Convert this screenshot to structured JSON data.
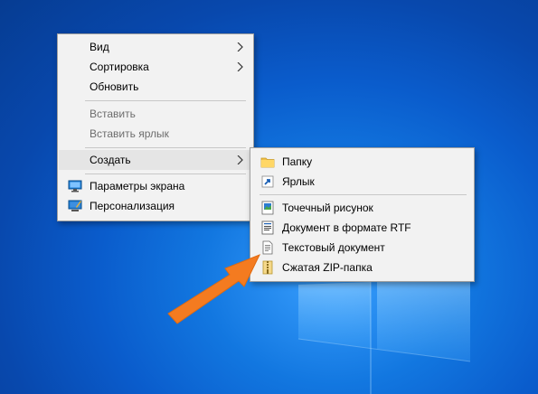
{
  "context_menu": {
    "items": [
      {
        "label": "Вид",
        "has_submenu": true
      },
      {
        "label": "Сортировка",
        "has_submenu": true
      },
      {
        "label": "Обновить"
      },
      {
        "label": "Вставить",
        "disabled": true
      },
      {
        "label": "Вставить ярлык",
        "disabled": true
      },
      {
        "label": "Создать",
        "has_submenu": true,
        "highlighted": true
      },
      {
        "label": "Параметры экрана",
        "icon": "display-settings-icon"
      },
      {
        "label": "Персонализация",
        "icon": "personalization-icon"
      }
    ]
  },
  "submenu_create": {
    "items": [
      {
        "label": "Папку",
        "icon": "folder-icon"
      },
      {
        "label": "Ярлык",
        "icon": "shortcut-icon"
      },
      {
        "label": "Точечный рисунок",
        "icon": "bitmap-icon"
      },
      {
        "label": "Документ в формате RTF",
        "icon": "rtf-document-icon"
      },
      {
        "label": "Текстовый документ",
        "icon": "text-document-icon"
      },
      {
        "label": "Сжатая ZIP-папка",
        "icon": "zip-folder-icon"
      }
    ]
  },
  "colors": {
    "desktop_bg": "#0a5ccc",
    "menu_bg": "#f2f2f2",
    "highlight": "#e5e5e5",
    "disabled_text": "#6d6d6d",
    "arrow": "#f47b20"
  }
}
